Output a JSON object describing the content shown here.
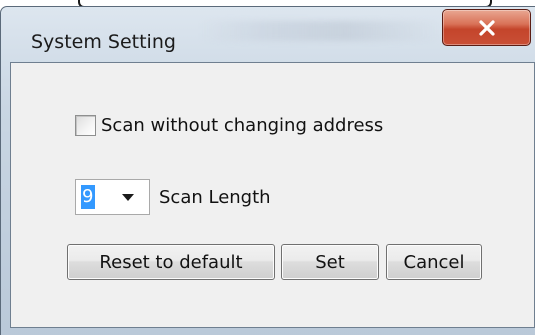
{
  "window": {
    "title": "System Setting",
    "close_icon": "close-icon"
  },
  "options": {
    "scan_without_changing_address": {
      "label": "Scan without changing address",
      "checked": false
    },
    "scan_length": {
      "value": "9",
      "label": "Scan Length",
      "dropdown_icon": "chevron-down-icon"
    }
  },
  "buttons": {
    "reset_label": "Reset to default",
    "set_label": "Set",
    "cancel_label": "Cancel"
  },
  "colors": {
    "close_button": "#c94f36",
    "selection_highlight": "#3399ff",
    "client_background": "#f0f0f0"
  }
}
